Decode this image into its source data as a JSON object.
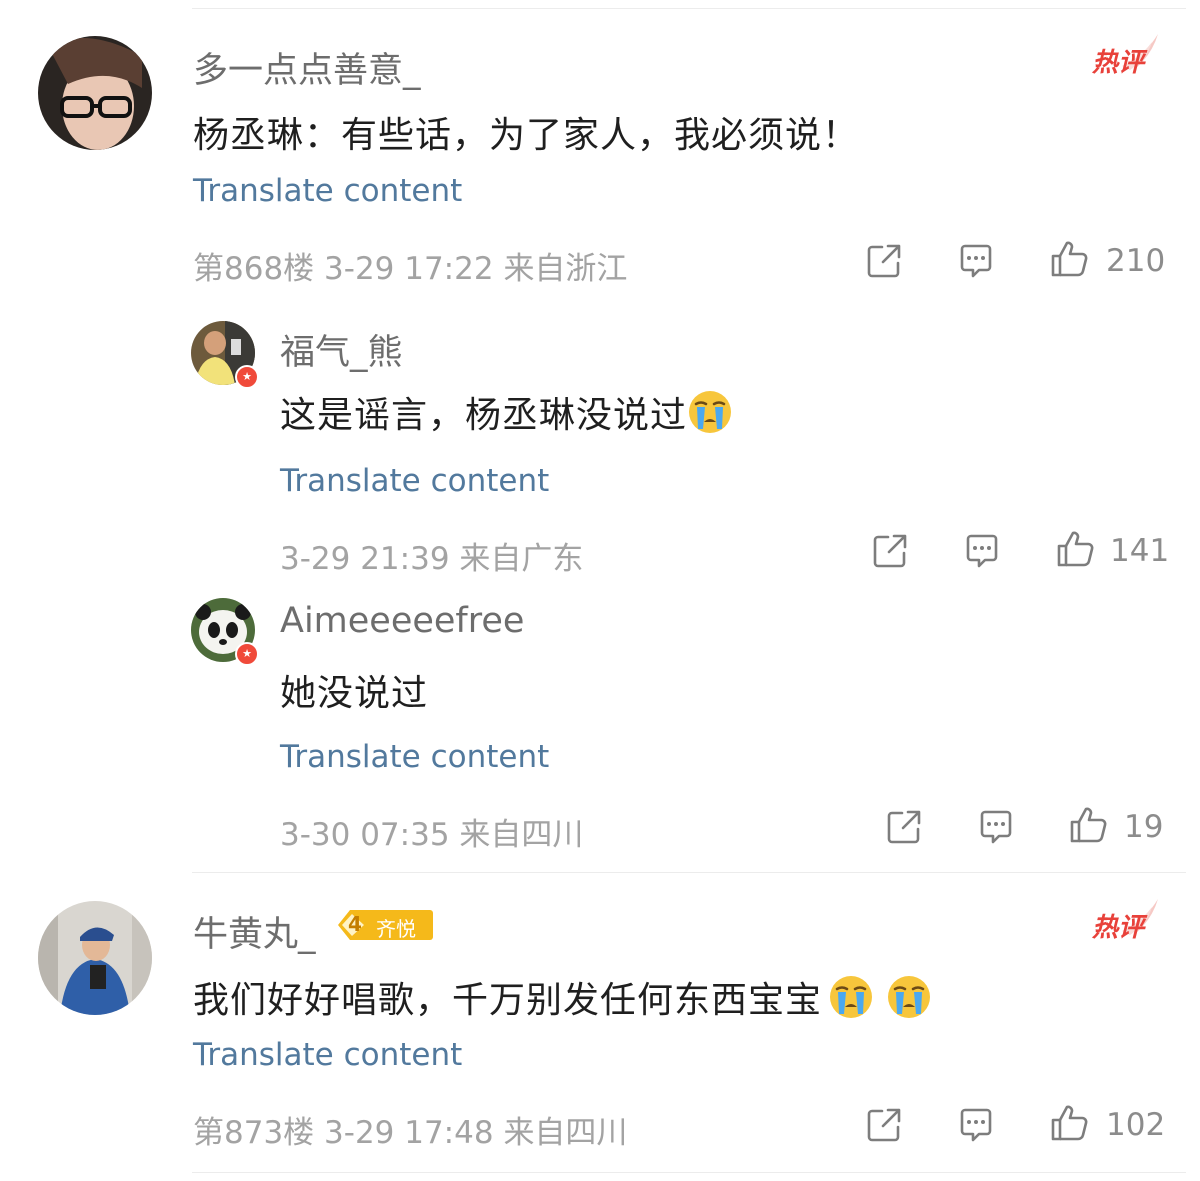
{
  "comments": [
    {
      "username": "多一点点善意_",
      "badge": "热评",
      "text": "杨丞琳：有些话，为了家人，我必须说！",
      "translate": "Translate content",
      "floor": "第868楼",
      "time": "3-29 17:22",
      "location": "来自浙江",
      "likes": "210"
    },
    {
      "username": "牛黄丸_",
      "badge": "热评",
      "level": "4",
      "level_label": "齐悦",
      "text": "我们好好唱歌，千万别发任何东西宝宝",
      "translate": "Translate content",
      "floor": "第873楼",
      "time": "3-29 17:48",
      "location": "来自四川",
      "likes": "102"
    }
  ],
  "replies": [
    {
      "username": "福气_熊",
      "text": "这是谣言，杨丞琳没说过",
      "translate": "Translate content",
      "time": "3-29 21:39",
      "location": "来自广东",
      "likes": "141"
    },
    {
      "username": "Aimeeeeefree",
      "text": "她没说过",
      "translate": "Translate content",
      "time": "3-30 07:35",
      "location": "来自四川",
      "likes": "19"
    }
  ],
  "icons": {
    "share": "share-icon",
    "comment": "comment-icon",
    "like": "thumbs-up-icon",
    "crying": "crying-emoji-icon"
  },
  "colors": {
    "hot_badge": "#e8413a",
    "translate_link": "#52799d",
    "verified_badge": "#f04a3a",
    "level_badge": "#f5b91a"
  }
}
